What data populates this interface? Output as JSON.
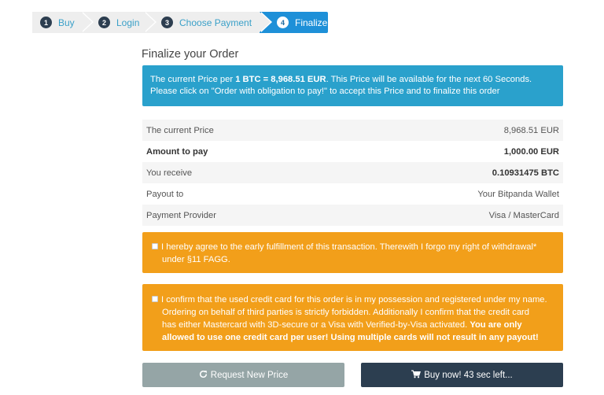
{
  "steps": [
    {
      "num": "1",
      "label": "Buy"
    },
    {
      "num": "2",
      "label": "Login"
    },
    {
      "num": "3",
      "label": "Choose Payment"
    },
    {
      "num": "4",
      "label": "Finalize"
    }
  ],
  "page_title": "Finalize your Order",
  "info": {
    "line1_prefix": "The current Price per ",
    "line1_bold": "1 BTC = 8,968.51 EUR",
    "line1_suffix": ". This Price will be available for the next 60 Seconds.",
    "line2": "Please click on \"Order with obligation to pay!\" to accept this Price and to finalize this order"
  },
  "summary": [
    {
      "label": "The current Price",
      "value": "8,968.51 EUR"
    },
    {
      "label": "Amount to pay",
      "value": "1,000.00 EUR"
    },
    {
      "label": "You receive",
      "value": "0.10931475 BTC"
    },
    {
      "label": "Payout to",
      "value": "Your Bitpanda Wallet"
    },
    {
      "label": "Payment Provider",
      "value": "Visa / MasterCard"
    }
  ],
  "agreement1": {
    "line1": "I hereby agree to the early fulfillment of this transaction. Therewith I forgo my right of withdrawal*",
    "line2": "under §11 FAGG."
  },
  "agreement2": {
    "line1": "I confirm that the used credit card for this order is in my possession and registered under my name.",
    "line2": "Ordering on behalf of third parties is strictly forbidden. Additionally I confirm that the credit card",
    "line3_normal": "has either Mastercard with 3D-secure or a Visa with Verified-by-Visa activated. ",
    "line3_bold": "You are only",
    "line4_bold": "allowed to use one credit card per user! Using multiple cards will not result in any payout!"
  },
  "buttons": {
    "request_new_price": "Request New Price",
    "buy_now": "Buy now! 43 sec left..."
  },
  "colors": {
    "active_step": "#1e90d8",
    "info_bg": "#2aa1cc",
    "warning_bg": "#f29f1a",
    "secondary_button": "#95a5a6",
    "primary_button": "#2c3e50"
  }
}
